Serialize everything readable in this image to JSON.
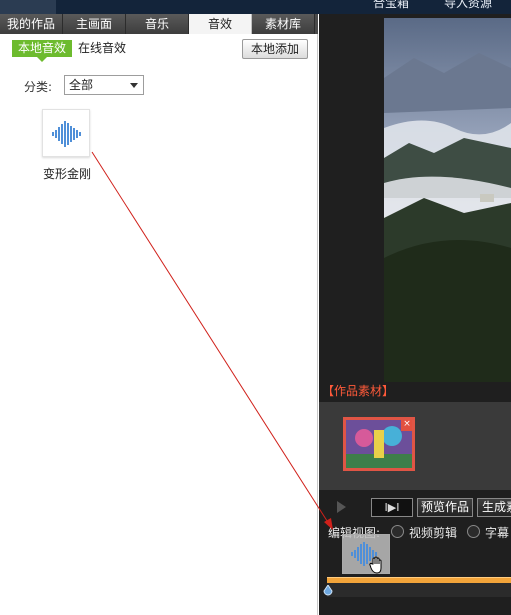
{
  "topbar": {
    "item1": "合宝箱",
    "item2": "导入资源"
  },
  "tabs": [
    {
      "label": "我的作品"
    },
    {
      "label": "主画面"
    },
    {
      "label": "音乐"
    },
    {
      "label": "音效"
    },
    {
      "label": "素材库"
    }
  ],
  "subtabs": {
    "local": "本地音效",
    "online": "在线音效"
  },
  "add_button": "本地添加",
  "category": {
    "label": "分类:",
    "value": "全部"
  },
  "sound": {
    "name": "变形金刚",
    "icon": "audio-wave-icon"
  },
  "right": {
    "material_title": "【作品素材】",
    "step_label": "I▶I",
    "preview_button": "预览作品",
    "generate_button": "生成素",
    "edit_label": "编辑视图:",
    "radio1": "视频剪辑",
    "radio2": "字幕"
  },
  "colors": {
    "accent_green": "#6dbb2e",
    "material_red": "#ff5a3a",
    "timeline_orange": "#f2a43a",
    "annotation_arrow": "#d0201a"
  }
}
